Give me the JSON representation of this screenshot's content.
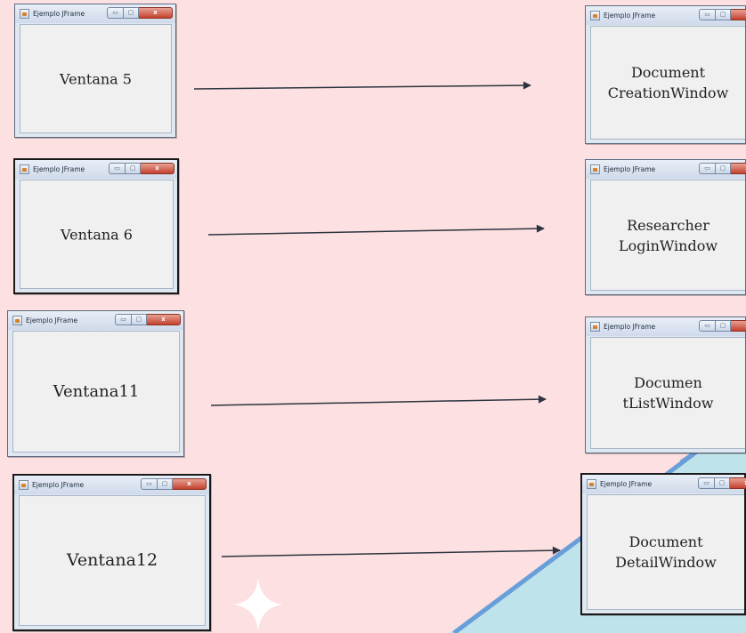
{
  "window_title": "Ejemplo JFrame",
  "close_glyph": "x",
  "max_glyph": "▢",
  "min_glyph": "▭",
  "colors": {
    "background": "#fde0e1",
    "accent_band": "#bfe3ea",
    "accent_stroke": "#6a9ed8",
    "arrow": "#2d3440"
  },
  "mappings": [
    {
      "source": "Ventana 5",
      "target": "Document\nCreationWindow"
    },
    {
      "source": "Ventana 6",
      "target": "Researcher\nLoginWindow"
    },
    {
      "source": "Ventana11",
      "target": "Documen\ntListWindow"
    },
    {
      "source": "Ventana12",
      "target": "Document\nDetailWindow"
    }
  ]
}
